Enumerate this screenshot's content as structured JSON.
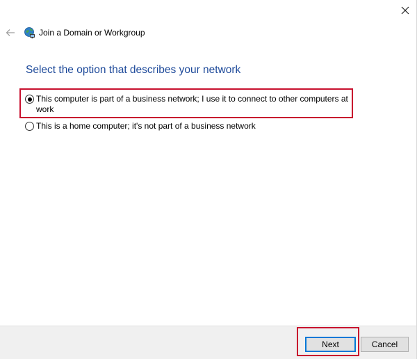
{
  "window": {
    "close_icon": "close-icon",
    "back_icon": "back-arrow-icon"
  },
  "header": {
    "title": "Join a Domain or Workgroup",
    "icon": "network-globe-icon"
  },
  "main": {
    "heading": "Select the option that describes your network",
    "options": [
      {
        "label": "This computer is part of a business network; I use it to connect to other computers at work",
        "selected": true
      },
      {
        "label": "This is a home computer; it's not part of a business network",
        "selected": false
      }
    ]
  },
  "footer": {
    "next_label": "Next",
    "cancel_label": "Cancel"
  },
  "colors": {
    "heading": "#1e4a9a",
    "highlight": "#c8102e",
    "default_button_border": "#0078d7",
    "footer_bg": "#f0f0f0"
  }
}
